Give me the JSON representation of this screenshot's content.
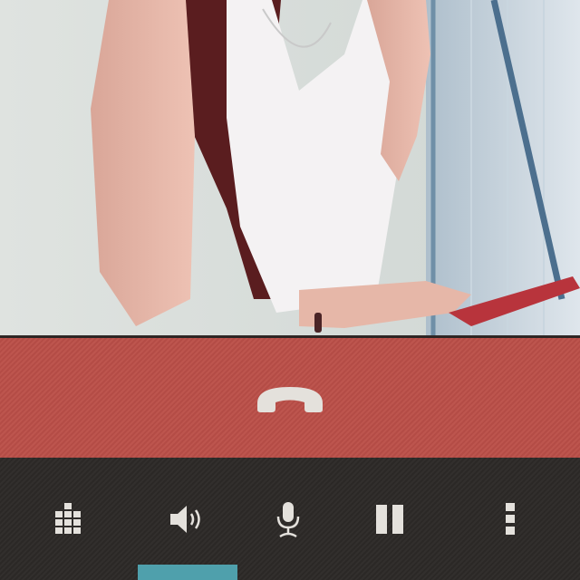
{
  "colors": {
    "end_call_bar": "#bb4f48",
    "control_bar": "#2d2a28",
    "icon": "#e4e1dc",
    "active_indicator": "#4fa0ac"
  },
  "photo": {
    "description_icon": "video-feed"
  },
  "end_call": {
    "icon": "phone-hangup-icon"
  },
  "controls": [
    {
      "id": "dialpad",
      "icon": "dialpad-icon"
    },
    {
      "id": "speaker",
      "icon": "speaker-icon",
      "active": true
    },
    {
      "id": "mute",
      "icon": "microphone-icon"
    },
    {
      "id": "hold",
      "icon": "pause-icon"
    },
    {
      "id": "more",
      "icon": "more-vertical-icon"
    }
  ]
}
